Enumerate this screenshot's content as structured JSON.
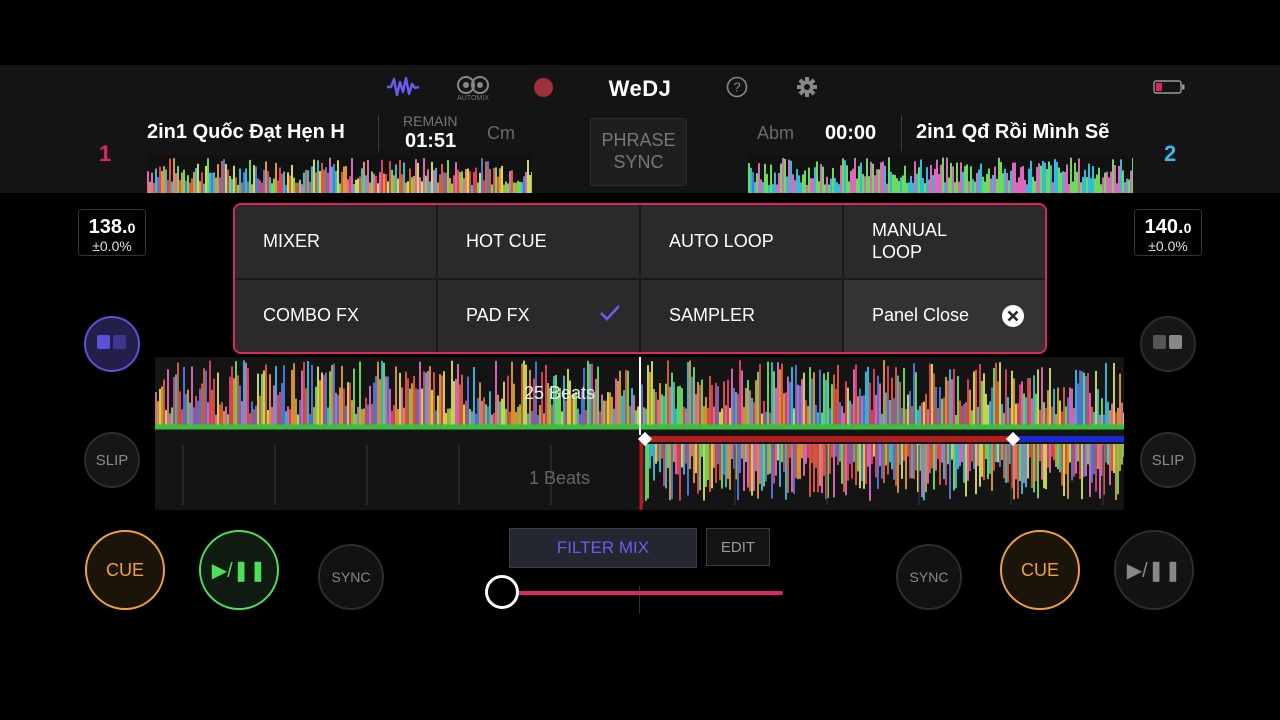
{
  "header": {
    "app_name": "WeDJ",
    "automix_label": "AUTOMIX",
    "icons": [
      "waveform-icon",
      "automix-icon",
      "record-icon",
      "help-icon",
      "settings-icon",
      "battery-icon"
    ]
  },
  "deck1": {
    "number": "1",
    "title": "2in1 Quốc Đạt Hẹn H",
    "remain_label": "REMAIN",
    "remain_time": "01:51",
    "key": "Cm",
    "bpm_main": "138.",
    "bpm_decimal": "0",
    "pitch": "±0.0%"
  },
  "deck2": {
    "number": "2",
    "title": "2in1 Qđ Rồi Mình Sẽ",
    "key": "Abm",
    "time": "00:00",
    "bpm_main": "140.",
    "bpm_decimal": "0",
    "pitch": "±0.0%"
  },
  "phrase_sync": {
    "line1": "PHRASE",
    "line2": "SYNC"
  },
  "panel": {
    "items": [
      {
        "label": "MIXER"
      },
      {
        "label": "HOT CUE"
      },
      {
        "label": "AUTO LOOP"
      },
      {
        "label": "MANUAL\nLOOP"
      },
      {
        "label": "COMBO FX"
      },
      {
        "label": "PAD FX",
        "checked": true
      },
      {
        "label": "SAMPLER"
      },
      {
        "label": "Panel Close"
      }
    ]
  },
  "waveform": {
    "upper_beats": "25 Beats",
    "lower_beats": "1 Beats"
  },
  "controls": {
    "slip": "SLIP",
    "cue": "CUE",
    "play": "▶/❚❚",
    "sync": "SYNC",
    "filter_mix": "FILTER MIX",
    "edit": "EDIT",
    "crossfader_value": 0.0
  },
  "colors": {
    "accent_pink": "#e0265f",
    "accent_purple": "#6b5cf0",
    "deck1_color": "#e0265f",
    "deck2_color": "#3fb8f0",
    "cue_orange": "#f0a23a",
    "play_green": "#4de05a"
  }
}
